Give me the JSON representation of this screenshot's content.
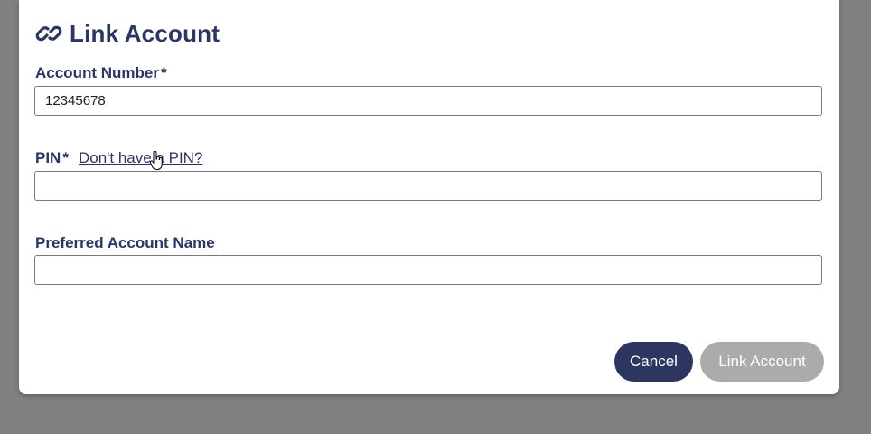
{
  "dialog": {
    "title": "Link Account",
    "title_icon": "link-icon"
  },
  "fields": {
    "account_number": {
      "label": "Account Number",
      "required_mark": "*",
      "value": ""
    },
    "pin": {
      "label": "PIN",
      "required_mark": "*",
      "help_link": "Don't have a PIN?",
      "value": ""
    },
    "preferred_name": {
      "label": "Preferred Account Name",
      "value": ""
    }
  },
  "account_number_value": "12345678",
  "buttons": {
    "cancel": "Cancel",
    "submit": "Link Account"
  },
  "colors": {
    "primary": "#2d3561",
    "disabled": "#ababab",
    "backdrop": "#808080"
  }
}
